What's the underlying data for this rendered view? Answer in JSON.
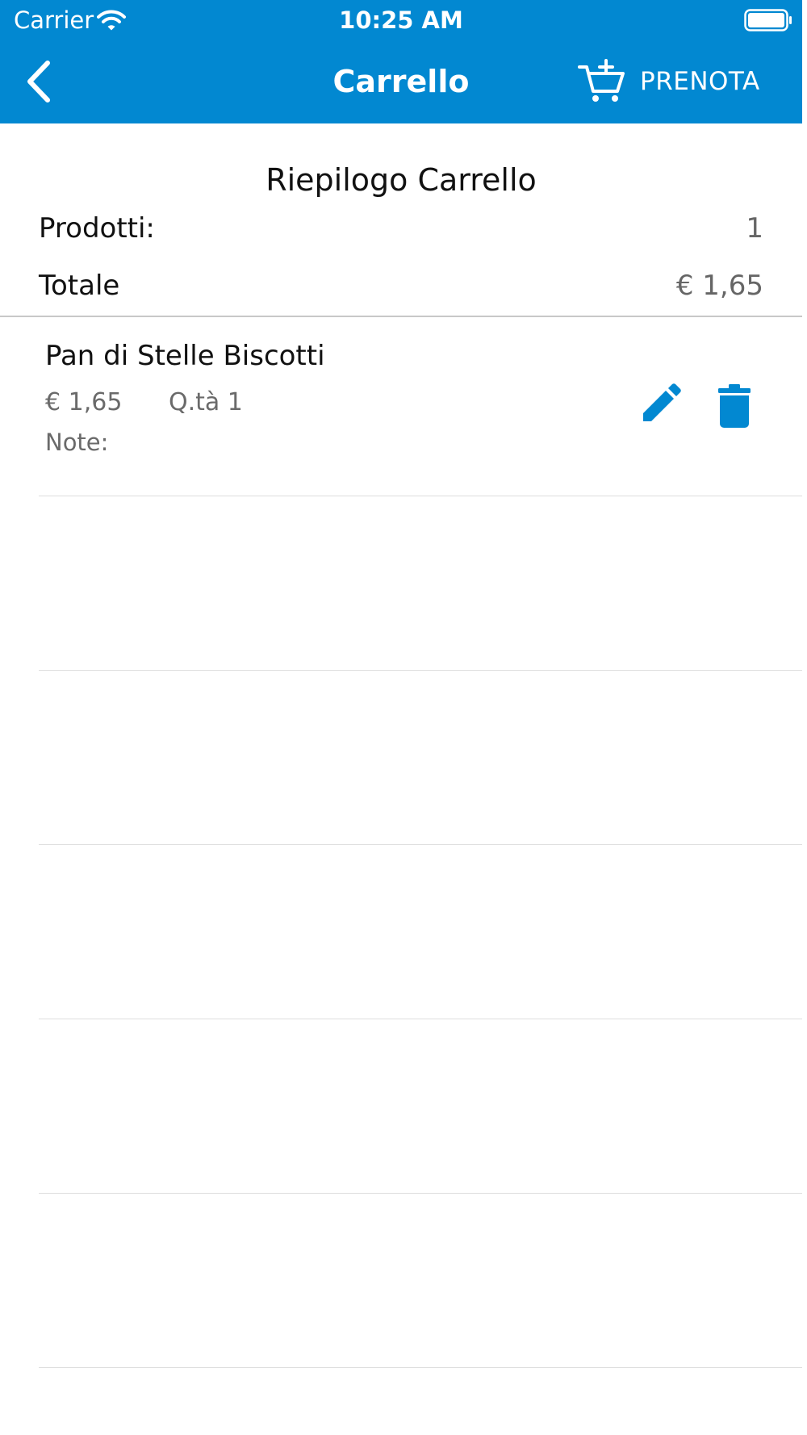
{
  "status_bar": {
    "carrier": "Carrier",
    "time": "10:25 AM",
    "icons": [
      "wifi-icon",
      "battery-icon"
    ]
  },
  "nav_bar": {
    "title": "Carrello",
    "back_icon": "chevron-left-icon",
    "action_icon": "cart-add-icon",
    "action_label": "PRENOTA"
  },
  "summary": {
    "title": "Riepilogo Carrello",
    "products_label": "Prodotti:",
    "products_value": "1",
    "total_label": "Totale",
    "total_value": "€ 1,65"
  },
  "cart_items": [
    {
      "name": "Pan di Stelle Biscotti",
      "price": "€ 1,65",
      "quantity": "Q.tà 1",
      "notes": "Note:",
      "actions": [
        "pencil-icon",
        "trash-icon"
      ]
    }
  ],
  "colors": {
    "primary": "#0288d1",
    "text_primary": "#111111",
    "text_secondary": "#6a6a6a",
    "divider": "#c8c8c8",
    "row_separator": "#dedede"
  }
}
